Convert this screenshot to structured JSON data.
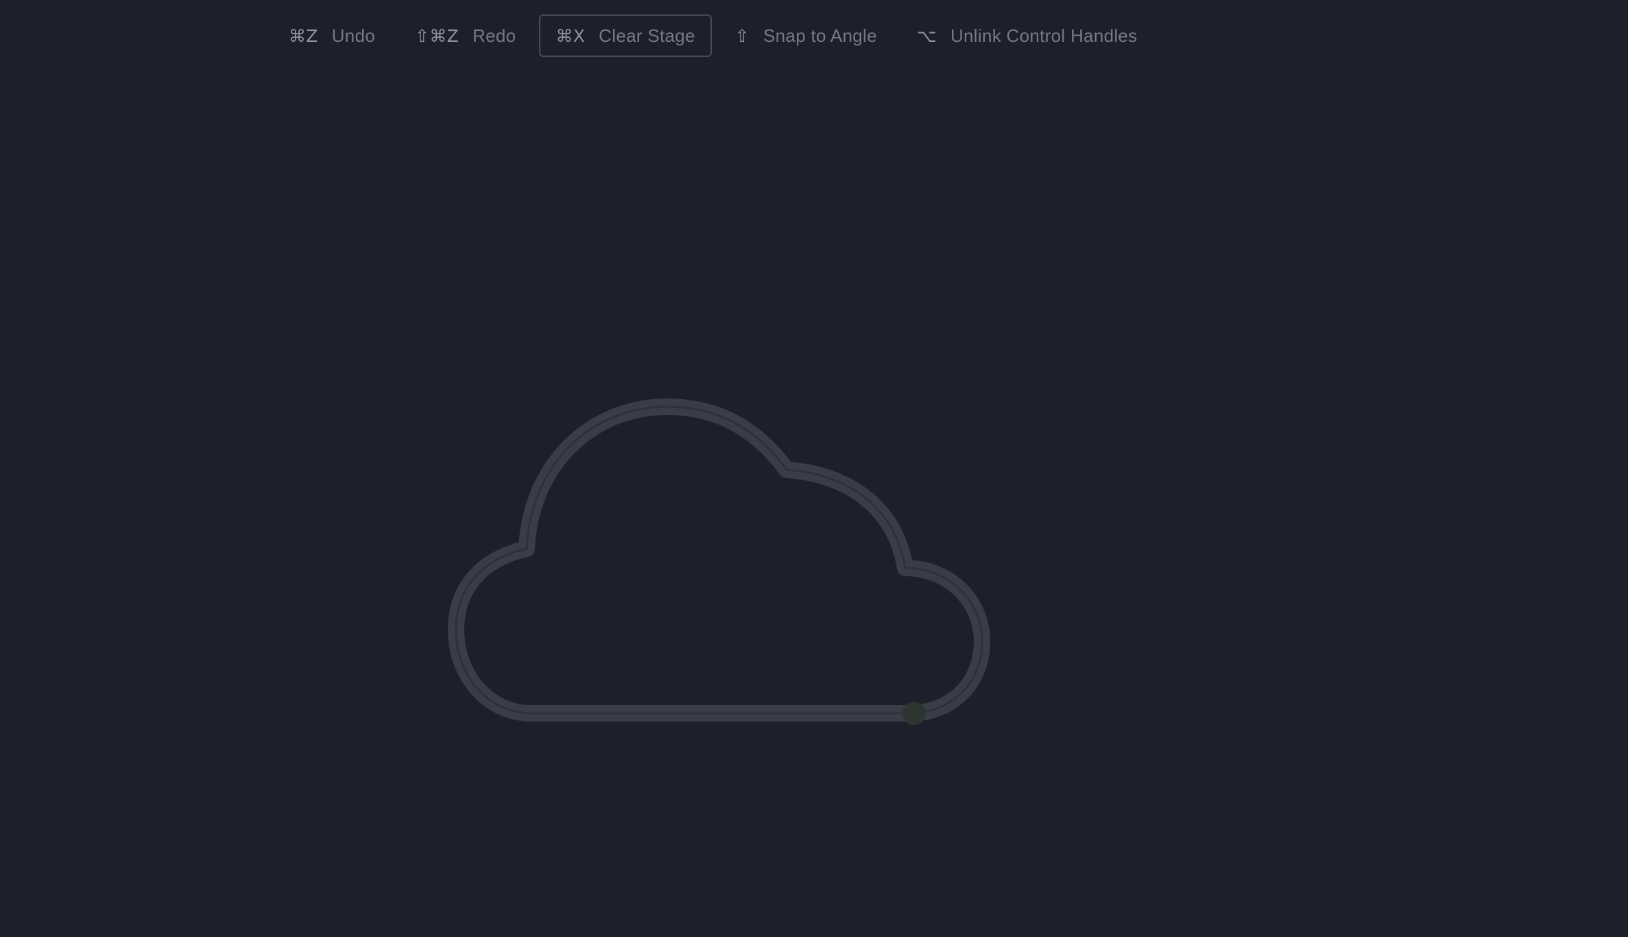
{
  "toolbar": {
    "tools": [
      {
        "key": "⌘Z",
        "label": "Undo"
      },
      {
        "key": "⇧⌘Z",
        "label": "Redo"
      },
      {
        "key": "⌘X",
        "label": "Clear Stage"
      },
      {
        "key": "⇧",
        "label": "Snap to Angle"
      },
      {
        "key": "⌥",
        "label": "Unlink Control Handles"
      }
    ]
  },
  "colors": {
    "background": "#1d202a",
    "path_stroke": "#3a3d47",
    "path_inner": "#2b2e38",
    "active_point": "#2c3530",
    "toolbar_text": "#7b7f89",
    "active_border": "#474b56"
  },
  "icons": {
    "undo": "command-z-icon",
    "redo": "shift-command-z-icon",
    "clear": "command-x-icon",
    "snap": "shift-icon",
    "unlink": "option-icon"
  }
}
